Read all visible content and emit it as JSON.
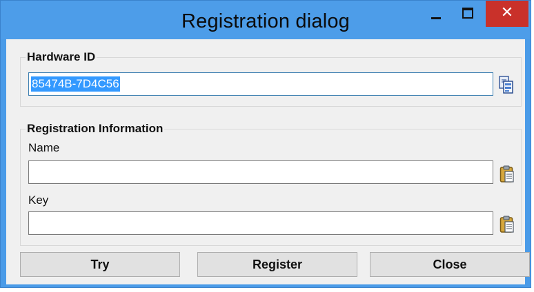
{
  "window": {
    "title": "Registration dialog",
    "minimize_label": "–",
    "maximize_label": "□",
    "close_label": "✕",
    "close_color": "#c9312a",
    "titlebar_color": "#4d9de9"
  },
  "hardware": {
    "legend": "Hardware ID",
    "value": "85474B-7D4C56",
    "copy_icon": "copy-icon"
  },
  "registration": {
    "legend": "Registration Information",
    "name_label": "Name",
    "name_value": "",
    "key_label": "Key",
    "key_value": "",
    "paste_icon": "paste-icon"
  },
  "buttons": {
    "try": "Try",
    "register": "Register",
    "close": "Close"
  }
}
